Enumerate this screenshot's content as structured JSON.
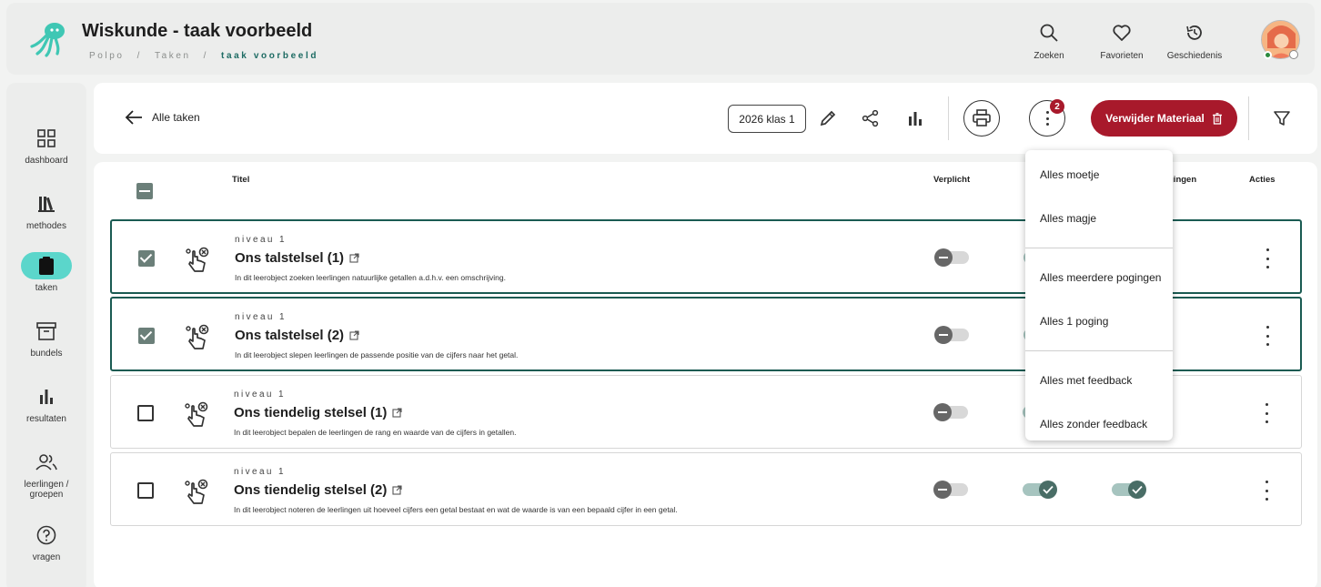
{
  "header": {
    "title": "Wiskunde - taak voorbeeld",
    "breadcrumb": [
      "Polpo",
      "Taken",
      "taak voorbeeld"
    ],
    "breadcrumb_sep": "/",
    "actions": [
      {
        "label": "Zoeken",
        "icon": "search-icon"
      },
      {
        "label": "Favorieten",
        "icon": "heart-icon"
      },
      {
        "label": "Geschiedenis",
        "icon": "history-icon"
      }
    ]
  },
  "sidebar": {
    "items": [
      {
        "label": "dashboard",
        "icon": "dashboard-icon"
      },
      {
        "label": "methodes",
        "icon": "books-icon"
      },
      {
        "label": "taken",
        "icon": "clipboard-icon",
        "active": true
      },
      {
        "label": "bundels",
        "icon": "archive-icon"
      },
      {
        "label": "resultaten",
        "icon": "bar-chart-icon"
      },
      {
        "label": "leerlingen /",
        "label2": "groepen",
        "icon": "users-icon"
      },
      {
        "label": "vragen",
        "icon": "help-icon"
      }
    ]
  },
  "toolbar": {
    "back_label": "Alle taken",
    "class_label": "2026 klas 1",
    "menu_badge": "2",
    "delete_label": "Verwijder Materiaal"
  },
  "table": {
    "columns": {
      "title": "Titel",
      "required": "Verplicht",
      "attempts": "gingen",
      "actions": "Acties"
    },
    "rows": [
      {
        "level": "niveau 1",
        "title": "Ons talstelsel (1)",
        "desc": "In dit leerobject zoeken leerlingen natuurlijke getallen a.d.h.v. een omschrijving.",
        "selected": true,
        "verplicht": false,
        "toggle2": true,
        "toggle3": true
      },
      {
        "level": "niveau 1",
        "title": "Ons talstelsel (2)",
        "desc": "In dit leerobject slepen leerlingen de passende positie van de cijfers naar het getal.",
        "selected": true,
        "verplicht": false,
        "toggle2": true,
        "toggle3": true
      },
      {
        "level": "niveau 1",
        "title": "Ons tiendelig stelsel (1)",
        "desc": "In dit leerobject bepalen de leerlingen de rang en waarde van de cijfers in getallen.",
        "selected": false,
        "verplicht": false,
        "toggle2": true,
        "toggle3": true
      },
      {
        "level": "niveau 1",
        "title": "Ons tiendelig stelsel (2)",
        "desc": "In dit leerobject noteren de leerlingen uit hoeveel cijfers een getal bestaat en wat de waarde is van een bepaald cijfer in een getal.",
        "selected": false,
        "verplicht": false,
        "toggle2": true,
        "toggle3": true
      }
    ]
  },
  "menu": {
    "items": [
      "Alles moetje",
      "Alles magje",
      "Alles meerdere pogingen",
      "Alles 1 poging",
      "Alles met feedback",
      "Alles zonder feedback"
    ]
  },
  "colors": {
    "accent": "#1d6b63",
    "danger": "#a8192b",
    "active_nav": "#5bd6cb"
  }
}
